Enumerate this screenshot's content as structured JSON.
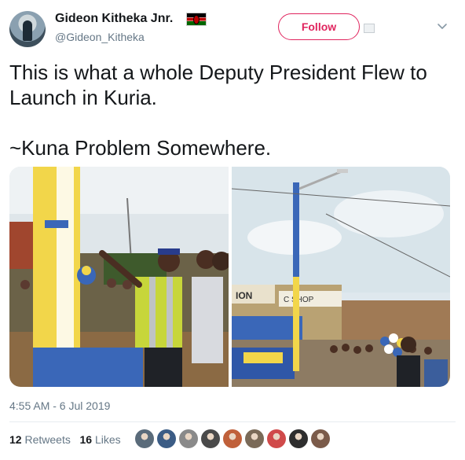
{
  "tweet": {
    "author_name": "Gideon Kitheka Jnr.",
    "author_handle": "@Gideon_Kitheka",
    "flag": "kenya-flag-emoji",
    "follow_label": "Follow",
    "text_line_1": "This is what a whole Deputy President Flew to Launch in Kuria.",
    "text_line_2": "~Kuna Problem Somewhere.",
    "timestamp": "4:55 AM - 6 Jul 2019",
    "retweets_count": "12",
    "retweets_label": "Retweets",
    "likes_count": "16",
    "likes_label": "Likes"
  },
  "media": {
    "left_photo_sign": "",
    "right_photo_sign_1": "ION",
    "right_photo_sign_2": "C SHOP"
  },
  "colors": {
    "brand_pink": "#e0245e",
    "secondary_text": "#657786",
    "divider": "#e6ecf0"
  },
  "likers": [
    {
      "color": "#5a6b7a"
    },
    {
      "color": "#3b5c85"
    },
    {
      "color": "#8a8a8a"
    },
    {
      "color": "#4a4a4a"
    },
    {
      "color": "#c0603a"
    },
    {
      "color": "#7a6a58"
    },
    {
      "color": "#d04a4a"
    },
    {
      "color": "#2e2e2e"
    },
    {
      "color": "#7b5b4a"
    }
  ]
}
